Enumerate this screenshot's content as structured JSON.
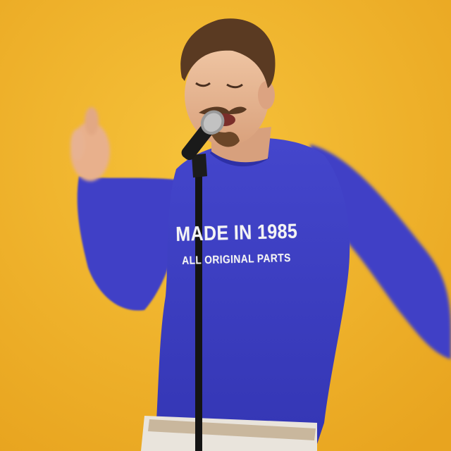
{
  "scene": {
    "background_color": "#f2b62a",
    "sweater_color": "#3d3fc4",
    "subject": "singer-at-microphone"
  },
  "shirt_print": {
    "line1": "MADE IN 1985",
    "line2": "ALL ORIGINAL PARTS"
  }
}
